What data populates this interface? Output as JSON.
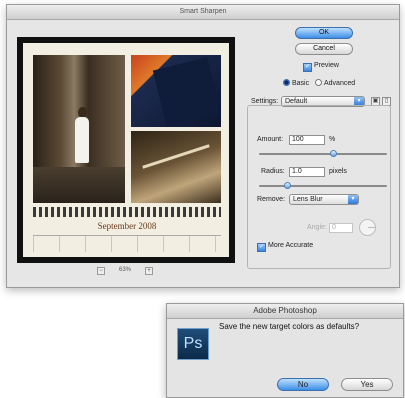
{
  "smart_sharpen": {
    "title": "Smart Sharpen",
    "ok_label": "OK",
    "cancel_label": "Cancel",
    "preview_label": "Preview",
    "preview_checked": true,
    "mode_basic_label": "Basic",
    "mode_advanced_label": "Advanced",
    "mode_selected": "Basic",
    "settings_label": "Settings:",
    "settings_value": "Default",
    "amount_label": "Amount:",
    "amount_value": "100",
    "amount_unit": "%",
    "radius_label": "Radius:",
    "radius_value": "1.0",
    "radius_unit": "pixels",
    "remove_label": "Remove:",
    "remove_value": "Lens Blur",
    "angle_label": "Angle:",
    "angle_value": "0",
    "more_accurate_label": "More Accurate",
    "more_accurate_checked": true,
    "zoom_value": "63%",
    "zoom_out_symbol": "−",
    "zoom_in_symbol": "+",
    "preview_image": {
      "calendar_title": "September 2008"
    }
  },
  "adobe_photoshop": {
    "title": "Adobe Photoshop",
    "icon_label": "Ps",
    "message": "Save the new target colors as defaults?",
    "no_label": "No",
    "yes_label": "Yes"
  },
  "icons": {
    "save_settings": "disk-icon",
    "delete_settings": "trash-icon",
    "angle_dial": "angle-dial-icon"
  },
  "colors": {
    "default_button": "#3d8ee6",
    "calendar_text": "#6a3a1a"
  }
}
